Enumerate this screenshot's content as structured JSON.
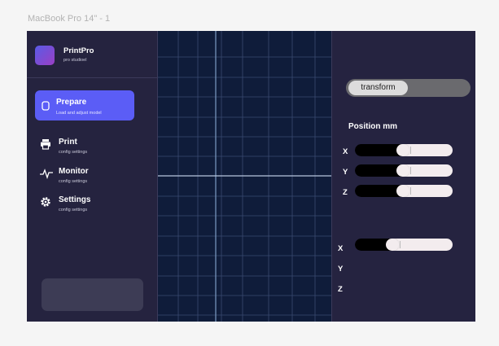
{
  "frame": {
    "label": "MacBook Pro 14\" - 1"
  },
  "brand": {
    "name": "PrintPro",
    "subtitle": "pro studioel",
    "gradient": [
      "#5a5be6",
      "#9a3fc4"
    ]
  },
  "nav": [
    {
      "id": "prepare",
      "title": "Prepare",
      "subtitle": "Load and adjust model",
      "icon": "prepare-icon",
      "active": true
    },
    {
      "id": "print",
      "title": "Print",
      "subtitle": "config settings",
      "icon": "printer-icon",
      "active": false
    },
    {
      "id": "monitor",
      "title": "Monitor",
      "subtitle": "config settings",
      "icon": "pulse-icon",
      "active": false
    },
    {
      "id": "settings",
      "title": "Settings",
      "subtitle": "config settings",
      "icon": "gear-icon",
      "active": false
    }
  ],
  "colors": {
    "accent": "#5b5df6",
    "background": "#232240",
    "canvas": "#0f1c3a",
    "grid": "#3a4a70"
  },
  "transform": {
    "toggle_label": "transform"
  },
  "position": {
    "title": "Position mm",
    "axes": [
      {
        "label": "X",
        "level": 0.49
      },
      {
        "label": "Y",
        "level": 0.49
      },
      {
        "label": "Z",
        "level": 0.49
      }
    ]
  },
  "rotation": {
    "axes": [
      {
        "label": "X",
        "level": 0.38
      },
      {
        "label": "Y"
      },
      {
        "label": "Z"
      }
    ]
  }
}
